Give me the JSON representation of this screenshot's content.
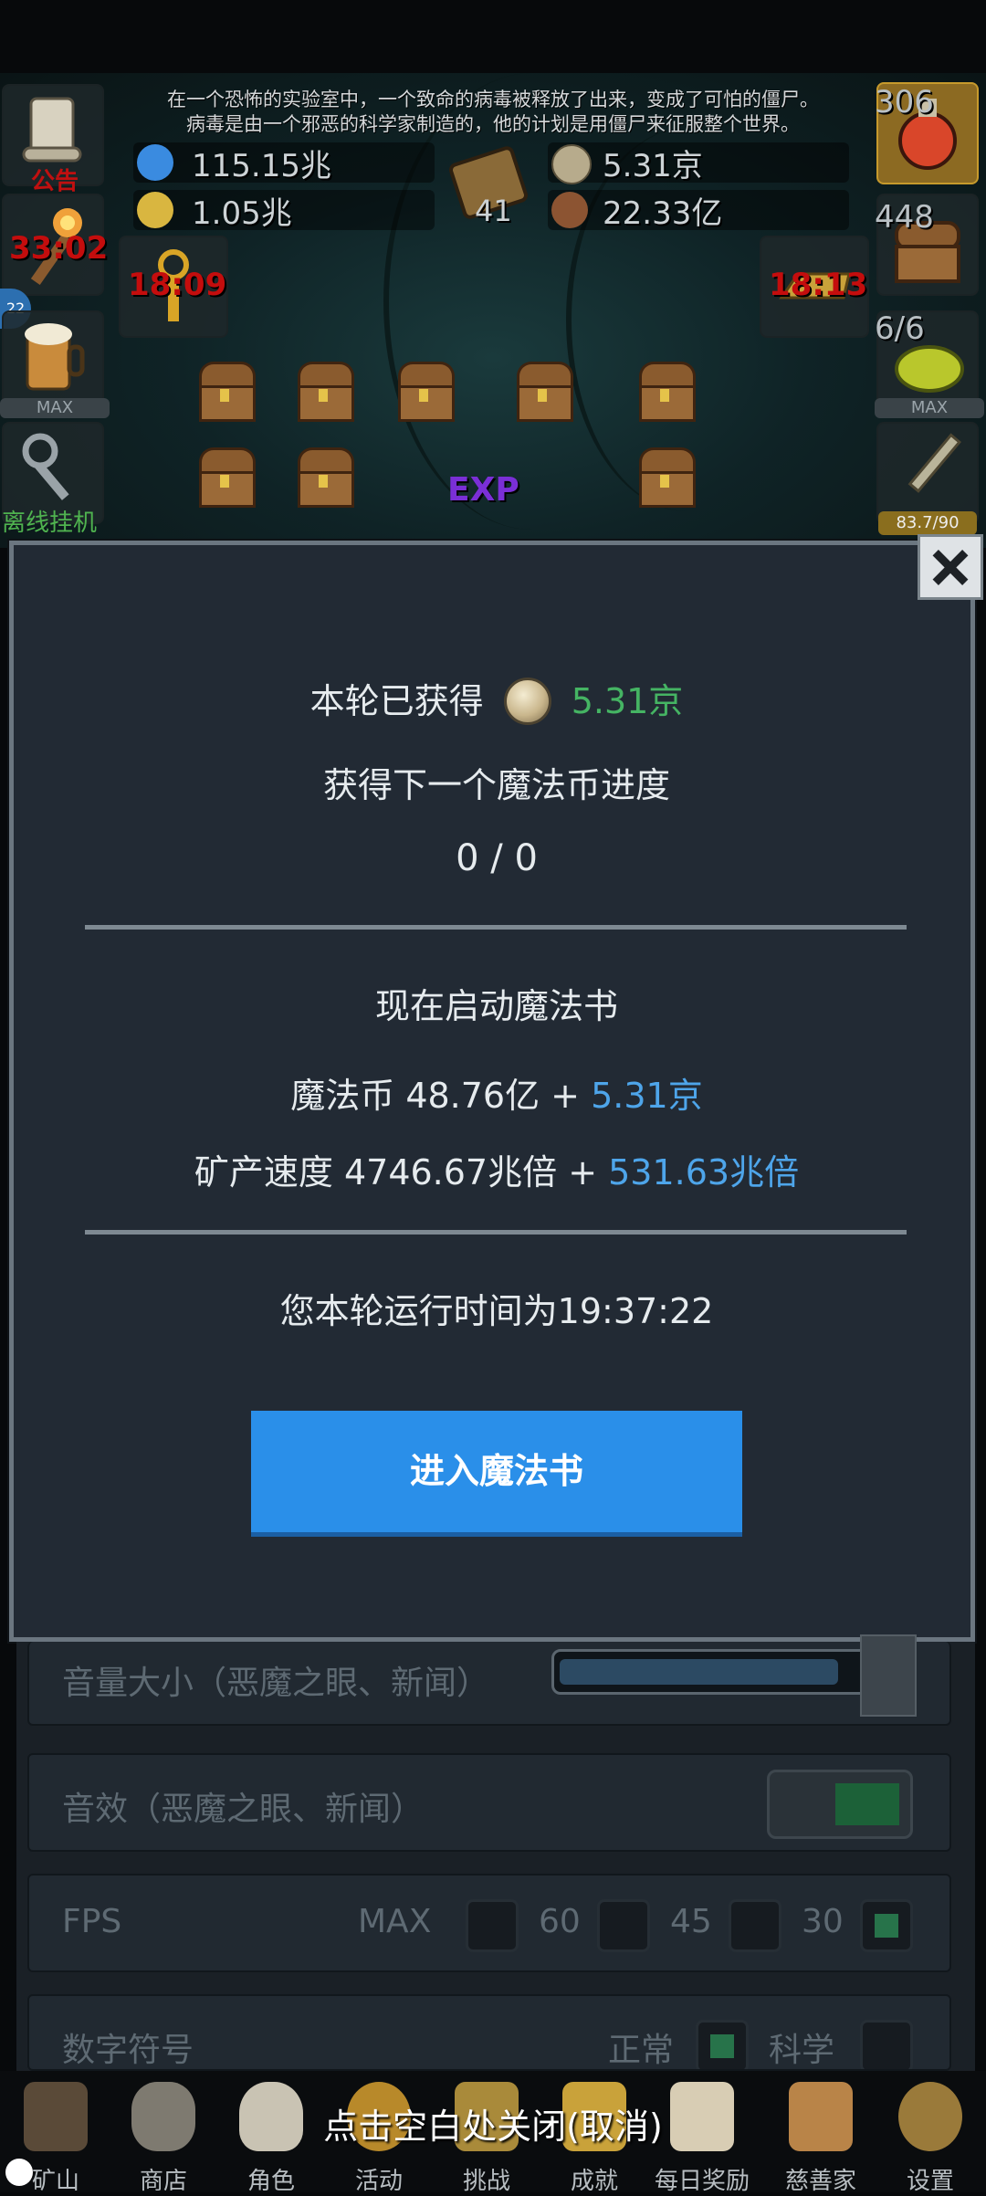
{
  "story": {
    "line1": "在一个恐怖的实验室中，一个致命的病毒被释放了出来，变成了可怕的僵尸。",
    "line2": "病毒是由一个邪恶的科学家制造的，他的计划是用僵尸来征服整个世界。"
  },
  "hud": {
    "announcement_label": "公告",
    "resource_blue": "115.15兆",
    "resource_yellow": "1.05兆",
    "book_count": "41",
    "coin_amount": "5.31京",
    "meat_amount": "22.33亿",
    "potion_count": "306",
    "chest_count": "448",
    "slime_count": "6/6",
    "sword_progress": "83.7/90",
    "timer_left": "33:02",
    "timer_mid": "18:09",
    "timer_right": "18:13",
    "level_badge": "22",
    "max_label_left": "MAX",
    "max_label_right": "MAX",
    "offline_label": "离线挂机",
    "exp_label": "EXP"
  },
  "dialog": {
    "earned_label": "本轮已获得",
    "earned_value": "5.31京",
    "progress_label": "获得下一个魔法币进度",
    "progress_value": "0 / 0",
    "start_now_label": "现在启动魔法书",
    "magic_coin_label": "魔法币 48.76亿 +",
    "magic_coin_bonus": "5.31京",
    "mining_speed_label": "矿产速度 4746.67兆倍 +",
    "mining_speed_bonus": "531.63兆倍",
    "runtime_label": "您本轮运行时间为19:37:22",
    "enter_button": "进入魔法书"
  },
  "settings": {
    "volume_label": "音量大小（恶魔之眼、新闻）",
    "volume_level": 0.92,
    "sfx_label": "音效（恶魔之眼、新闻）",
    "sfx_on": true,
    "fps_label": "FPS",
    "fps_options": [
      "MAX",
      "60",
      "45",
      "30"
    ],
    "fps_selected": "30",
    "number_label": "数字符号",
    "number_options": [
      "正常",
      "科学"
    ],
    "number_selected": "正常"
  },
  "close_hint": "点击空白处关闭(取消)",
  "nav": [
    {
      "label": "矿山",
      "icon": "lantern-icon"
    },
    {
      "label": "商店",
      "icon": "rock-icon"
    },
    {
      "label": "角色",
      "icon": "skull-icon"
    },
    {
      "label": "活动",
      "icon": "ring-icon"
    },
    {
      "label": "挑战",
      "icon": "key-icon"
    },
    {
      "label": "成就",
      "icon": "trophy-icon"
    },
    {
      "label": "每日奖励",
      "icon": "envelope-icon"
    },
    {
      "label": "慈善家",
      "icon": "bread-icon"
    },
    {
      "label": "设置",
      "icon": "gear-icon"
    }
  ],
  "colors": {
    "accent_blue": "#2a8fe9",
    "bonus_green": "#45b463",
    "bonus_blue": "#4ea5ea",
    "timer_red": "#c40d0d"
  }
}
